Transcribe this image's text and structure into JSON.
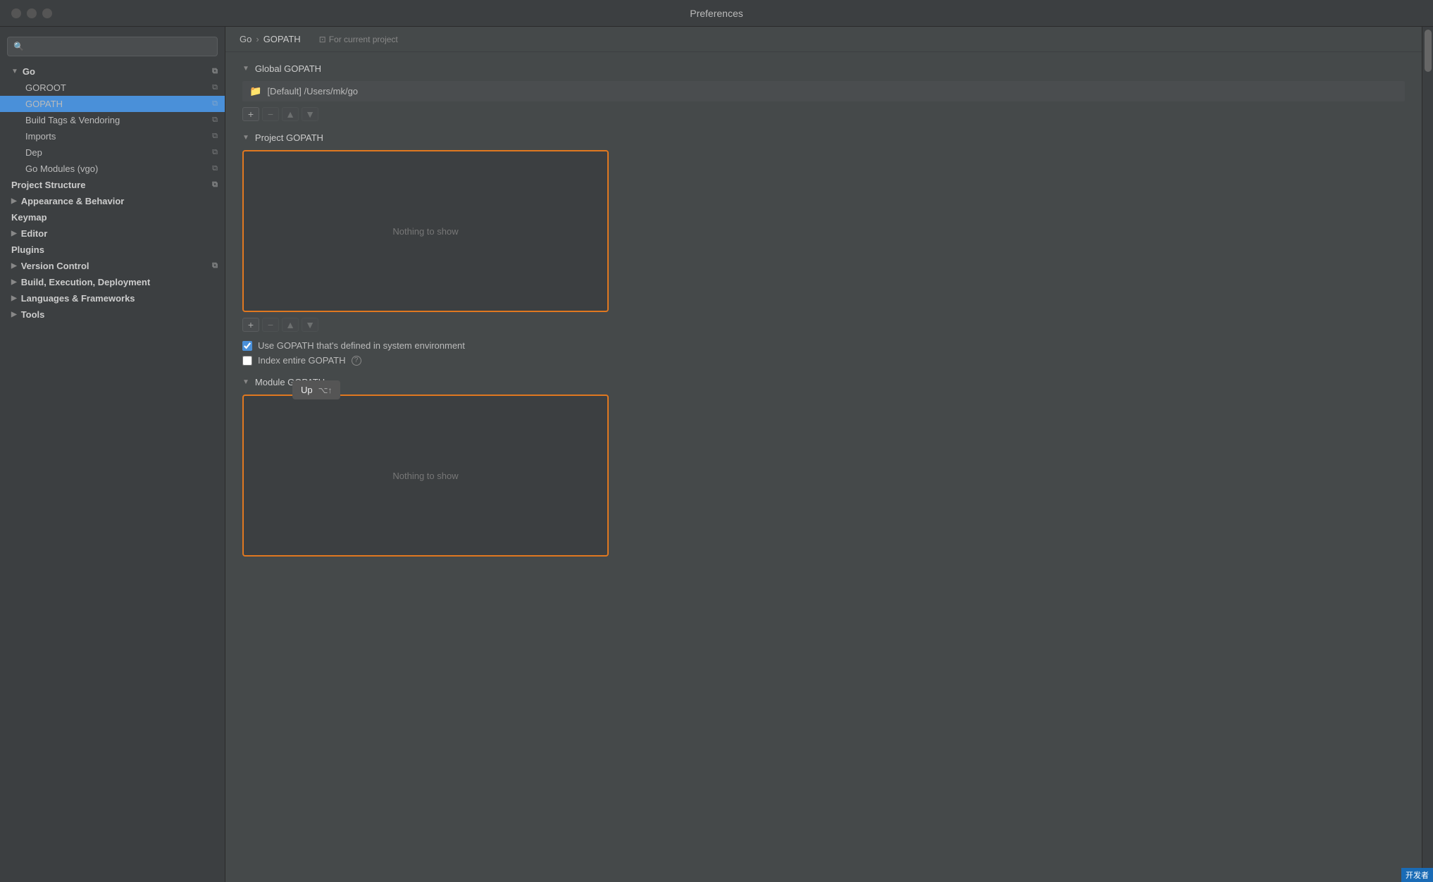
{
  "titleBar": {
    "title": "Preferences"
  },
  "sidebar": {
    "searchPlaceholder": "🔍",
    "items": [
      {
        "id": "go",
        "label": "Go",
        "level": "top",
        "expanded": true,
        "hasCopy": true,
        "hasArrow": true
      },
      {
        "id": "goroot",
        "label": "GOROOT",
        "level": "sub",
        "hasCopy": true
      },
      {
        "id": "gopath",
        "label": "GOPATH",
        "level": "sub",
        "hasCopy": true,
        "active": true
      },
      {
        "id": "build-tags",
        "label": "Build Tags & Vendoring",
        "level": "sub",
        "hasCopy": true
      },
      {
        "id": "imports",
        "label": "Imports",
        "level": "sub",
        "hasCopy": true
      },
      {
        "id": "dep",
        "label": "Dep",
        "level": "sub",
        "hasCopy": true
      },
      {
        "id": "go-modules",
        "label": "Go Modules (vgo)",
        "level": "sub",
        "hasCopy": true
      },
      {
        "id": "project-structure",
        "label": "Project Structure",
        "level": "top",
        "hasCopy": true
      },
      {
        "id": "appearance",
        "label": "Appearance & Behavior",
        "level": "top",
        "hasArrow": true
      },
      {
        "id": "keymap",
        "label": "Keymap",
        "level": "top"
      },
      {
        "id": "editor",
        "label": "Editor",
        "level": "top",
        "hasArrow": true
      },
      {
        "id": "plugins",
        "label": "Plugins",
        "level": "top"
      },
      {
        "id": "version-control",
        "label": "Version Control",
        "level": "top",
        "hasArrow": true,
        "hasCopy": true
      },
      {
        "id": "build-execution",
        "label": "Build, Execution, Deployment",
        "level": "top",
        "hasArrow": true
      },
      {
        "id": "languages",
        "label": "Languages & Frameworks",
        "level": "top",
        "hasArrow": true
      },
      {
        "id": "tools",
        "label": "Tools",
        "level": "top",
        "hasArrow": true
      }
    ]
  },
  "content": {
    "breadcrumb": {
      "parent": "Go",
      "current": "GOPATH",
      "project_label": "For current project"
    },
    "globalGopath": {
      "sectionLabel": "Global GOPATH",
      "entry": "[Default] /Users/mk/go"
    },
    "toolbar1": {
      "addLabel": "+",
      "removeLabel": "−",
      "upLabel": "▲",
      "downLabel": "▼"
    },
    "projectGopath": {
      "sectionLabel": "Project GOPATH",
      "emptyText": "Nothing to show"
    },
    "toolbar2": {
      "addLabel": "+",
      "removeLabel": "−",
      "upLabel": "▲",
      "downLabel": "▼"
    },
    "checkboxes": {
      "useGopath": {
        "label": "Use GOPATH that's defined in system environment",
        "checked": true
      },
      "indexGopath": {
        "label": "Index entire GOPATH",
        "checked": false
      }
    },
    "moduleGopath": {
      "sectionLabel": "Module GOPATH",
      "emptyText": "Nothing to show"
    }
  },
  "tooltip": {
    "label": "Up",
    "shortcut": "⌥↑"
  },
  "watermark": {
    "text": "开发者"
  },
  "colors": {
    "accent": "#4a90d9",
    "orange": "#e07820",
    "bg_dark": "#3c3f41",
    "bg_main": "#45494a"
  }
}
